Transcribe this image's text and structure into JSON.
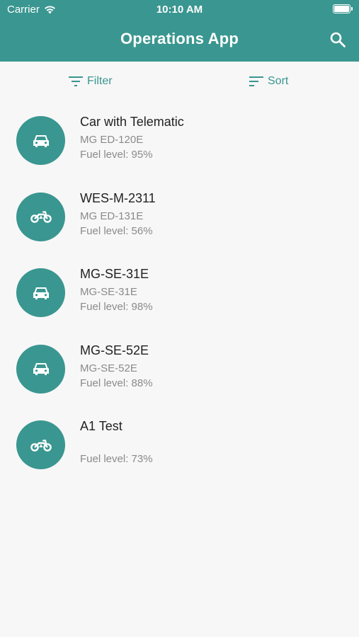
{
  "status_bar": {
    "carrier": "Carrier",
    "time": "10:10 AM"
  },
  "app_bar": {
    "title": "Operations App",
    "search_icon": "search-icon"
  },
  "toolbar": {
    "filter_label": "Filter",
    "sort_label": "Sort"
  },
  "colors": {
    "primary": "#3a9690",
    "background": "#f7f7f7",
    "secondary_text": "#8a8a8a"
  },
  "vehicles": [
    {
      "icon": "car-icon",
      "name": "Car with Telematic",
      "plate": "MG ED-120E",
      "fuel": "Fuel level: 95%"
    },
    {
      "icon": "motorcycle-icon",
      "name": "WES-M-2311",
      "plate": "MG ED-131E",
      "fuel": "Fuel level: 56%"
    },
    {
      "icon": "car-icon",
      "name": "MG-SE-31E",
      "plate": "MG-SE-31E",
      "fuel": "Fuel level: 98%"
    },
    {
      "icon": "car-icon",
      "name": "MG-SE-52E",
      "plate": "MG-SE-52E",
      "fuel": "Fuel level: 88%"
    },
    {
      "icon": "motorcycle-icon",
      "name": "A1 Test",
      "plate": "",
      "fuel": "Fuel level: 73%"
    }
  ]
}
